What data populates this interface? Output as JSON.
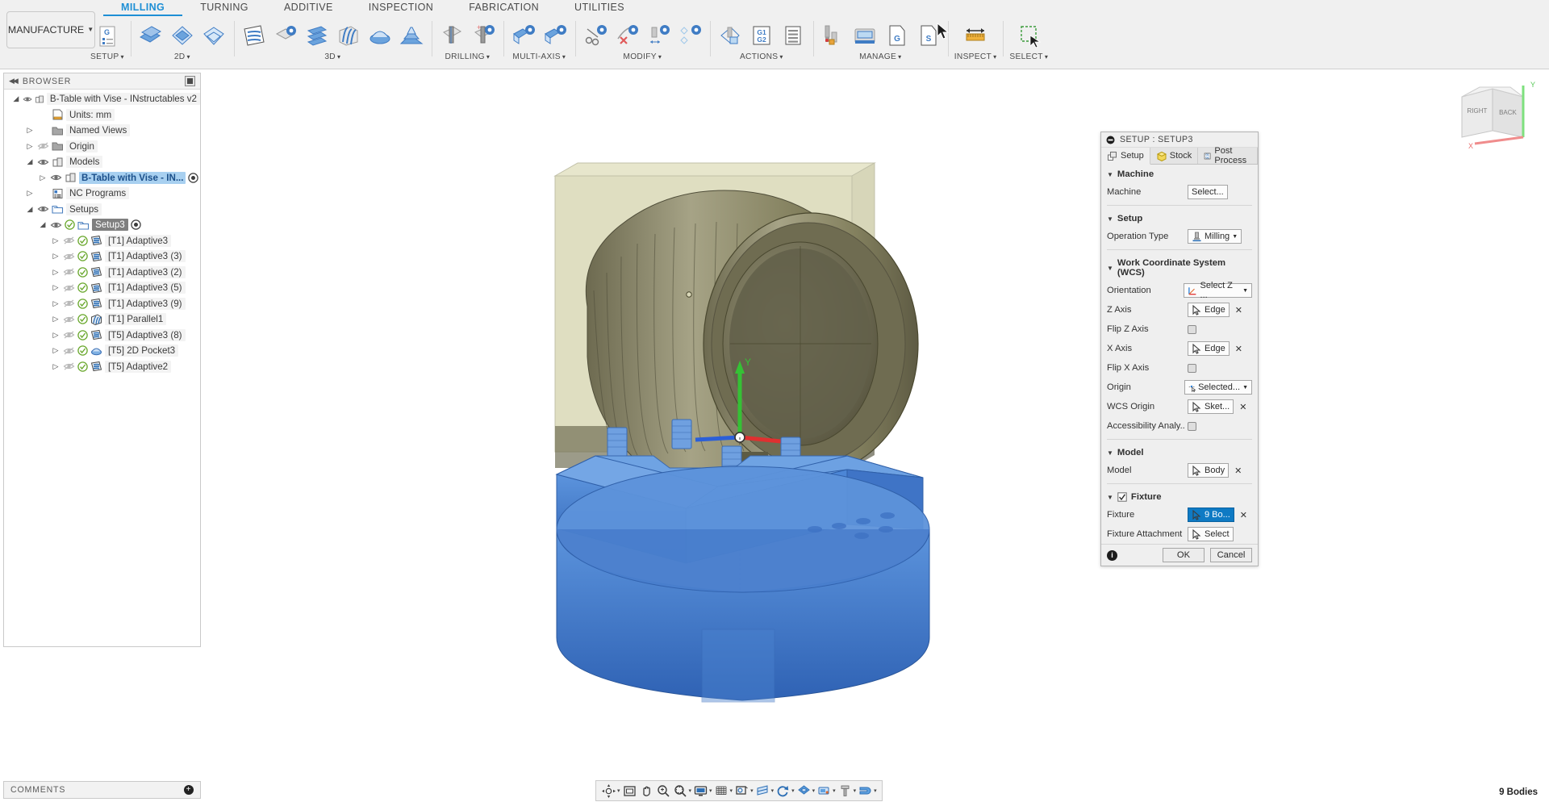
{
  "app": {
    "workspace_button": "MANUFACTURE",
    "tabs": [
      {
        "label": "MILLING",
        "active": true
      },
      {
        "label": "TURNING",
        "active": false
      },
      {
        "label": "ADDITIVE",
        "active": false
      },
      {
        "label": "INSPECTION",
        "active": false
      },
      {
        "label": "FABRICATION",
        "active": false
      },
      {
        "label": "UTILITIES",
        "active": false
      }
    ],
    "panels": [
      {
        "label": "SETUP",
        "dropdown": true,
        "icons": [
          "setup-g-code-icon"
        ]
      },
      {
        "label": "2D",
        "dropdown": true,
        "icons": [
          "face-icon",
          "pocket-2d-icon",
          "contour-2d-icon"
        ]
      },
      {
        "label": "3D",
        "dropdown": true,
        "icons": [
          "adaptive-clearing-icon",
          "pocket-clearing-icon",
          "horizontal-icon",
          "parallel-icon",
          "scallop-icon",
          "spiral-icon"
        ]
      },
      {
        "label": "DRILLING",
        "dropdown": true,
        "icons": [
          "drill-icon",
          "bore-icon"
        ]
      },
      {
        "label": "MULTI-AXIS",
        "dropdown": true,
        "icons": [
          "swarf-icon",
          "multi-axis-contour-icon"
        ]
      },
      {
        "label": "MODIFY",
        "dropdown": true,
        "icons": [
          "trim-tool-icon",
          "delete-toolpath-icon",
          "tool-orientation-icon",
          "probe-icon"
        ]
      },
      {
        "label": "ACTIONS",
        "dropdown": true,
        "icons": [
          "simulate-icon",
          "g1-g2-icon",
          "setup-sheet-icon"
        ]
      },
      {
        "label": "MANAGE",
        "dropdown": true,
        "icons": [
          "tool-library-icon",
          "machine-library-icon",
          "post-library-icon",
          "template-library-icon"
        ]
      },
      {
        "label": "INSPECT",
        "dropdown": true,
        "icons": [
          "measure-icon"
        ]
      },
      {
        "label": "SELECT",
        "dropdown": true,
        "icons": [
          "select-window-icon"
        ]
      }
    ]
  },
  "browser": {
    "header": "BROWSER",
    "collapse_icon": "collapse-left-icon",
    "options_icon": "browser-options-icon",
    "tree": [
      {
        "indent": 0,
        "arrow": "open",
        "eye": "on",
        "icon": "document-icon",
        "label": "B-Table with Vise - INstructables v2",
        "highlight": false,
        "radio": false,
        "check": false
      },
      {
        "indent": 1,
        "arrow": "none",
        "eye": "none",
        "icon": "units-icon",
        "label": "Units: mm",
        "highlight": false,
        "radio": false,
        "check": false
      },
      {
        "indent": 1,
        "arrow": "closed",
        "eye": "none",
        "icon": "folder-icon",
        "label": "Named Views",
        "highlight": false,
        "radio": false,
        "check": false
      },
      {
        "indent": 1,
        "arrow": "closed",
        "eye": "off",
        "icon": "folder-icon",
        "label": "Origin",
        "highlight": false,
        "radio": false,
        "check": false
      },
      {
        "indent": 1,
        "arrow": "open",
        "eye": "on",
        "icon": "component-icon",
        "label": "Models",
        "highlight": false,
        "radio": false,
        "check": false
      },
      {
        "indent": 2,
        "arrow": "closed",
        "eye": "on",
        "icon": "component-icon",
        "label": "B-Table with Vise - IN...",
        "highlight": true,
        "radio": true,
        "check": false
      },
      {
        "indent": 1,
        "arrow": "closed",
        "eye": "none",
        "icon": "nc-program-icon",
        "label": "NC Programs",
        "highlight": false,
        "radio": false,
        "check": false
      },
      {
        "indent": 1,
        "arrow": "open",
        "eye": "on",
        "icon": "setup-folder-icon",
        "label": "Setups",
        "highlight": false,
        "radio": false,
        "check": false
      },
      {
        "indent": 2,
        "arrow": "open",
        "eye": "on",
        "icon": "setup-folder-icon",
        "label": "Setup3",
        "highlight": false,
        "selected": true,
        "radio": true,
        "check": true
      },
      {
        "indent": 3,
        "arrow": "closed",
        "eye": "off",
        "icon": "adaptive-op-icon",
        "label": "[T1] Adaptive3",
        "highlight": false,
        "radio": false,
        "check": true
      },
      {
        "indent": 3,
        "arrow": "closed",
        "eye": "off",
        "icon": "adaptive-op-icon",
        "label": "[T1] Adaptive3 (3)",
        "highlight": false,
        "radio": false,
        "check": true
      },
      {
        "indent": 3,
        "arrow": "closed",
        "eye": "off",
        "icon": "adaptive-op-icon",
        "label": "[T1] Adaptive3 (2)",
        "highlight": false,
        "radio": false,
        "check": true
      },
      {
        "indent": 3,
        "arrow": "closed",
        "eye": "off",
        "icon": "adaptive-op-icon",
        "label": "[T1] Adaptive3 (5)",
        "highlight": false,
        "radio": false,
        "check": true
      },
      {
        "indent": 3,
        "arrow": "closed",
        "eye": "off",
        "icon": "adaptive-op-icon",
        "label": "[T1] Adaptive3 (9)",
        "highlight": false,
        "radio": false,
        "check": true
      },
      {
        "indent": 3,
        "arrow": "closed",
        "eye": "off",
        "icon": "parallel-op-icon",
        "label": "[T1] Parallel1",
        "highlight": false,
        "radio": false,
        "check": true
      },
      {
        "indent": 3,
        "arrow": "closed",
        "eye": "off",
        "icon": "adaptive-op-icon",
        "label": "[T5] Adaptive3 (8)",
        "highlight": false,
        "radio": false,
        "check": true
      },
      {
        "indent": 3,
        "arrow": "closed",
        "eye": "off",
        "icon": "pocket-op-icon",
        "label": "[T5] 2D Pocket3",
        "highlight": false,
        "radio": false,
        "check": true
      },
      {
        "indent": 3,
        "arrow": "closed",
        "eye": "off",
        "icon": "adaptive-op-icon",
        "label": "[T5] Adaptive2",
        "highlight": false,
        "radio": false,
        "check": true
      }
    ]
  },
  "setup_panel": {
    "title": "SETUP : SETUP3",
    "minimize_icon": "minimize-icon",
    "tabs": [
      {
        "label": "Setup",
        "icon": "setup-tab-icon",
        "active": true
      },
      {
        "label": "Stock",
        "icon": "stock-tab-icon",
        "active": false
      },
      {
        "label": "Post Process",
        "icon": "post-process-tab-icon",
        "active": false
      }
    ],
    "sections": [
      {
        "title": "Machine",
        "rows": [
          {
            "label": "Machine",
            "control": "button",
            "value": "Select...",
            "icon": "",
            "clear": false,
            "dropdown": false
          }
        ]
      },
      {
        "title": "Setup",
        "rows": [
          {
            "label": "Operation Type",
            "control": "dropdown",
            "value": "Milling",
            "icon": "milling-icon",
            "clear": false,
            "dropdown": true
          }
        ]
      },
      {
        "title": "Work Coordinate System (WCS)",
        "rows": [
          {
            "label": "Orientation",
            "control": "dropdown",
            "value": "Select Z ...",
            "icon": "axis-orientation-icon",
            "clear": false,
            "dropdown": true
          },
          {
            "label": "Z Axis",
            "control": "select",
            "value": "Edge",
            "icon": "cursor-select-icon",
            "clear": true,
            "dropdown": false
          },
          {
            "label": "Flip Z Axis",
            "control": "checkbox",
            "value": "",
            "icon": "",
            "clear": false,
            "dropdown": false
          },
          {
            "label": "X Axis",
            "control": "select",
            "value": "Edge",
            "icon": "cursor-select-icon",
            "clear": true,
            "dropdown": false
          },
          {
            "label": "Flip X Axis",
            "control": "checkbox",
            "value": "",
            "icon": "",
            "clear": false,
            "dropdown": false
          },
          {
            "label": "Origin",
            "control": "dropdown",
            "value": "Selected...",
            "icon": "origin-point-icon",
            "clear": false,
            "dropdown": true
          },
          {
            "label": "WCS Origin",
            "control": "select",
            "value": "Sket...",
            "icon": "cursor-select-icon",
            "clear": true,
            "dropdown": false
          },
          {
            "label": "Accessibility Analy...",
            "control": "checkbox",
            "value": "",
            "icon": "",
            "clear": false,
            "dropdown": false
          }
        ]
      },
      {
        "title": "Model",
        "rows": [
          {
            "label": "Model",
            "control": "select",
            "value": "Body",
            "icon": "cursor-select-icon",
            "clear": true,
            "dropdown": false
          }
        ]
      },
      {
        "title": "Fixture",
        "checkbox": true,
        "rows": [
          {
            "label": "Fixture",
            "control": "select",
            "value": "9 Bo...",
            "icon": "cursor-select-icon",
            "clear": true,
            "dropdown": false,
            "accent": true
          },
          {
            "label": "Fixture Attachment",
            "control": "select",
            "value": "Select",
            "icon": "cursor-select-icon",
            "clear": false,
            "dropdown": false
          }
        ]
      }
    ],
    "footer": {
      "info_icon": "info-icon",
      "ok": "OK",
      "cancel": "Cancel"
    }
  },
  "viewcube": {
    "face_left": "RIGHT",
    "face_right": "BACK",
    "axis_x": "X",
    "axis_y": "Y"
  },
  "status_bar": {
    "comments": "COMMENTS",
    "add_comment_icon": "add-comment-icon",
    "body_count": "9 Bodies"
  },
  "nav_bar": {
    "items": [
      {
        "icon": "orbit-icon",
        "dropdown": true
      },
      {
        "icon": "fit-icon",
        "dropdown": false
      },
      {
        "icon": "pan-icon",
        "dropdown": false
      },
      {
        "icon": "zoom-icon",
        "dropdown": false
      },
      {
        "icon": "zoom-window-icon",
        "dropdown": true
      },
      {
        "icon": "display-settings-icon",
        "dropdown": true
      },
      {
        "icon": "grid-snap-icon",
        "dropdown": true
      },
      {
        "icon": "viewports-icon",
        "dropdown": true
      },
      {
        "icon": "section-analysis-icon",
        "dropdown": true
      },
      {
        "icon": "refresh-toolpath-icon",
        "dropdown": true
      },
      {
        "icon": "machine-visibility-icon",
        "dropdown": true
      },
      {
        "icon": "stock-visibility-icon",
        "dropdown": true
      },
      {
        "icon": "tool-visibility-icon",
        "dropdown": true
      },
      {
        "icon": "fixture-visibility-icon",
        "dropdown": true
      }
    ]
  },
  "colors": {
    "accent": "#1e8fd5",
    "fixture_blue": "#3f7ed0",
    "stock_olive": "#ccca9a",
    "model_bronze": "#7d7a5e",
    "axis_x": "#e03030",
    "axis_y": "#35c135",
    "axis_z": "#2b5fd8",
    "check_green": "#6aa82e"
  }
}
